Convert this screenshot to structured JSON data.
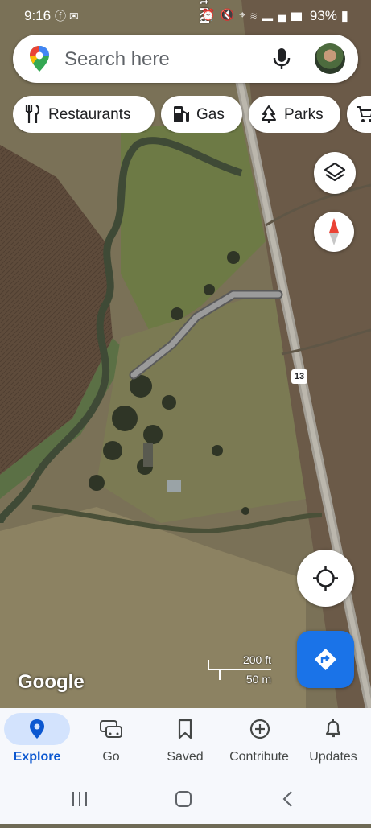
{
  "status_bar": {
    "time": "9:16",
    "left_icons": [
      "facebook-icon",
      "mail-icon"
    ],
    "right_icons": [
      "alarm-icon",
      "mute-icon",
      "location-icon",
      "wifi-icon",
      "signal-icon"
    ],
    "battery": "93%"
  },
  "map": {
    "road_name_label": "t Rd",
    "route_shield": "13",
    "scale_top": "200 ft",
    "scale_bottom": "50 m",
    "attribution": "Google"
  },
  "search": {
    "placeholder": "Search here",
    "icons": [
      "maps-pin-icon",
      "mic-icon",
      "avatar"
    ]
  },
  "chips": [
    {
      "label": "Restaurants",
      "icon": "restaurant-icon"
    },
    {
      "label": "Gas",
      "icon": "gas-station-icon"
    },
    {
      "label": "Parks",
      "icon": "tree-icon"
    },
    {
      "label": "",
      "icon": "cart-icon"
    }
  ],
  "map_controls": [
    "layers-icon",
    "compass-icon",
    "my-location-icon",
    "directions-icon"
  ],
  "bottom_nav": [
    {
      "label": "Explore",
      "icon": "pin-icon",
      "active": true
    },
    {
      "label": "Go",
      "icon": "car-icon",
      "active": false
    },
    {
      "label": "Saved",
      "icon": "bookmark-icon",
      "active": false
    },
    {
      "label": "Contribute",
      "icon": "add-circle-icon",
      "active": false
    },
    {
      "label": "Updates",
      "icon": "bell-icon",
      "active": false
    }
  ],
  "system_nav": [
    "recents-icon",
    "home-icon",
    "back-icon"
  ],
  "colors": {
    "accent": "#1a73e8",
    "active_nav": "#0b57d0",
    "active_pill": "#d3e3fd",
    "nav_bg": "#f6f8fc"
  }
}
